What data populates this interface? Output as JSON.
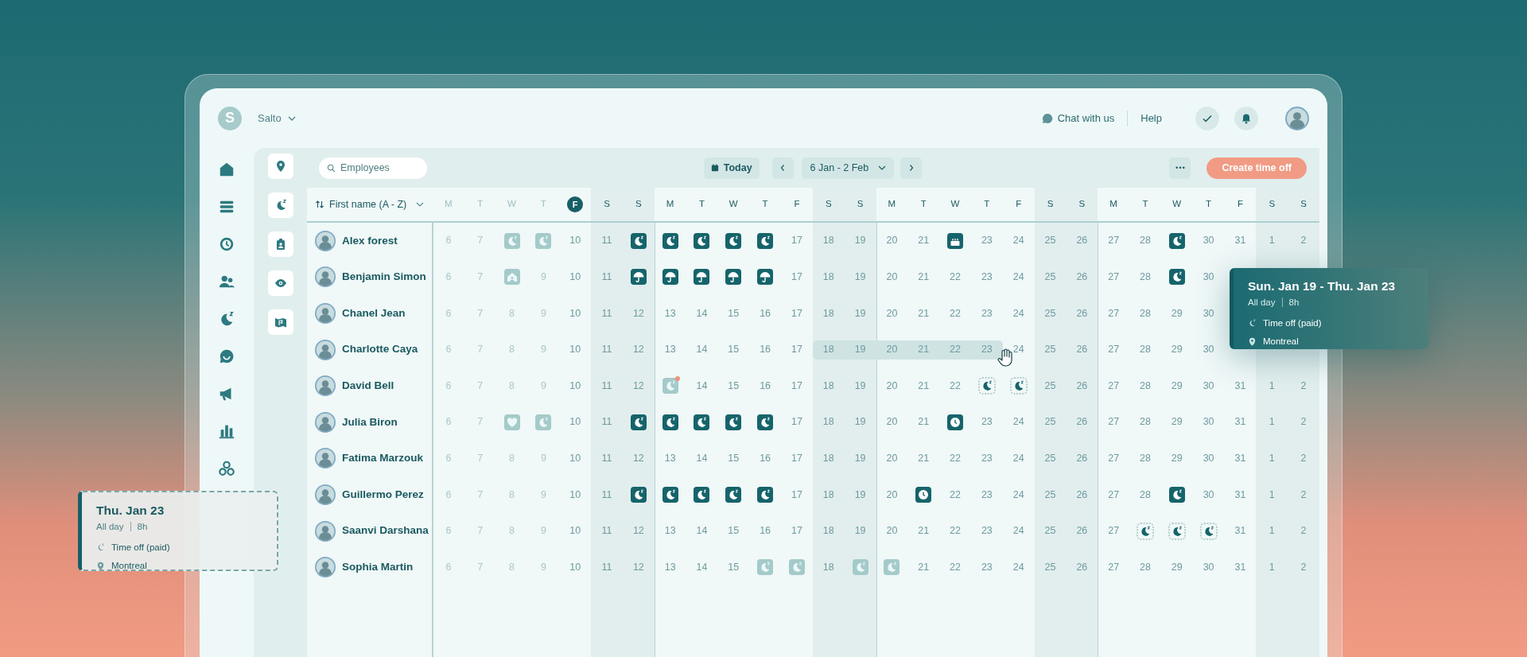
{
  "header": {
    "logo_initial": "S",
    "workspace": "Salto",
    "chat": "Chat with us",
    "help": "Help"
  },
  "toolbar": {
    "search": {
      "placeholder": "Employees"
    },
    "today": "Today",
    "date_range": "6 Jan - 2 Feb",
    "create": "Create time off"
  },
  "table": {
    "sort_label": "First name (A - Z)",
    "days": [
      {
        "letter": "M",
        "kind": "past",
        "weekend": false,
        "week_start": true
      },
      {
        "letter": "T",
        "kind": "past",
        "weekend": false,
        "week_start": false
      },
      {
        "letter": "W",
        "kind": "past",
        "weekend": false,
        "week_start": false
      },
      {
        "letter": "T",
        "kind": "past",
        "weekend": false,
        "week_start": false
      },
      {
        "letter": "F",
        "kind": "today",
        "weekend": false,
        "week_start": false
      },
      {
        "letter": "S",
        "kind": "day",
        "weekend": true,
        "week_start": false
      },
      {
        "letter": "S",
        "kind": "day",
        "weekend": true,
        "week_start": false
      },
      {
        "letter": "M",
        "kind": "day",
        "weekend": false,
        "week_start": true
      },
      {
        "letter": "T",
        "kind": "day",
        "weekend": false,
        "week_start": false
      },
      {
        "letter": "W",
        "kind": "day",
        "weekend": false,
        "week_start": false
      },
      {
        "letter": "T",
        "kind": "day",
        "weekend": false,
        "week_start": false
      },
      {
        "letter": "F",
        "kind": "day",
        "weekend": false,
        "week_start": false
      },
      {
        "letter": "S",
        "kind": "day",
        "weekend": true,
        "week_start": false
      },
      {
        "letter": "S",
        "kind": "day",
        "weekend": true,
        "week_start": false
      },
      {
        "letter": "M",
        "kind": "day",
        "weekend": false,
        "week_start": true
      },
      {
        "letter": "T",
        "kind": "day",
        "weekend": false,
        "week_start": false
      },
      {
        "letter": "W",
        "kind": "day",
        "weekend": false,
        "week_start": false
      },
      {
        "letter": "T",
        "kind": "day",
        "weekend": false,
        "week_start": false
      },
      {
        "letter": "F",
        "kind": "day",
        "weekend": false,
        "week_start": false
      },
      {
        "letter": "S",
        "kind": "day",
        "weekend": true,
        "week_start": false
      },
      {
        "letter": "S",
        "kind": "day",
        "weekend": true,
        "week_start": false
      },
      {
        "letter": "M",
        "kind": "day",
        "weekend": false,
        "week_start": true
      },
      {
        "letter": "T",
        "kind": "day",
        "weekend": false,
        "week_start": false
      },
      {
        "letter": "W",
        "kind": "day",
        "weekend": false,
        "week_start": false
      },
      {
        "letter": "T",
        "kind": "day",
        "weekend": false,
        "week_start": false
      },
      {
        "letter": "F",
        "kind": "day",
        "weekend": false,
        "week_start": false
      },
      {
        "letter": "S",
        "kind": "day",
        "weekend": true,
        "week_start": false
      },
      {
        "letter": "S",
        "kind": "day",
        "weekend": true,
        "week_start": false
      }
    ],
    "rows": [
      {
        "name": "Alex forest",
        "cells": [
          {
            "kind": "past",
            "text": "6"
          },
          {
            "kind": "past",
            "text": "7"
          },
          {
            "kind": "moon",
            "faded": true,
            "pending": false
          },
          {
            "kind": "moon",
            "faded": true,
            "pending": false
          },
          {
            "kind": "day",
            "text": "10"
          },
          {
            "kind": "day",
            "text": "11"
          },
          {
            "kind": "moon",
            "faded": false,
            "pending": false
          },
          {
            "kind": "moon",
            "faded": false,
            "pending": false
          },
          {
            "kind": "moon",
            "faded": false,
            "pending": false
          },
          {
            "kind": "moon",
            "faded": false,
            "pending": false
          },
          {
            "kind": "moon",
            "faded": false,
            "pending": false
          },
          {
            "kind": "day",
            "text": "17"
          },
          {
            "kind": "day",
            "text": "18"
          },
          {
            "kind": "day",
            "text": "19"
          },
          {
            "kind": "day",
            "text": "20"
          },
          {
            "kind": "day",
            "text": "21"
          },
          {
            "kind": "cake",
            "faded": false,
            "pending": false
          },
          {
            "kind": "day",
            "text": "23"
          },
          {
            "kind": "day",
            "text": "24"
          },
          {
            "kind": "day",
            "text": "25"
          },
          {
            "kind": "day",
            "text": "26"
          },
          {
            "kind": "day",
            "text": "27"
          },
          {
            "kind": "day",
            "text": "28"
          },
          {
            "kind": "moon",
            "faded": false,
            "pending": false
          },
          {
            "kind": "day",
            "text": "30"
          },
          {
            "kind": "day",
            "text": "31"
          },
          {
            "kind": "day",
            "text": "1"
          },
          {
            "kind": "day",
            "text": "2"
          }
        ]
      },
      {
        "name": "Benjamin Simon",
        "cells": [
          {
            "kind": "past",
            "text": "6"
          },
          {
            "kind": "past",
            "text": "7"
          },
          {
            "kind": "house",
            "faded": true,
            "pending": false
          },
          {
            "kind": "past",
            "text": "9"
          },
          {
            "kind": "day",
            "text": "10"
          },
          {
            "kind": "day",
            "text": "11"
          },
          {
            "kind": "umbrella",
            "faded": false,
            "pending": false
          },
          {
            "kind": "umbrella",
            "faded": false,
            "pending": false
          },
          {
            "kind": "umbrella",
            "faded": false,
            "pending": false
          },
          {
            "kind": "umbrella",
            "faded": false,
            "pending": false
          },
          {
            "kind": "umbrella",
            "faded": false,
            "pending": false
          },
          {
            "kind": "day",
            "text": "17"
          },
          {
            "kind": "day",
            "text": "18"
          },
          {
            "kind": "day",
            "text": "19"
          },
          {
            "kind": "day",
            "text": "20"
          },
          {
            "kind": "day",
            "text": "21"
          },
          {
            "kind": "day",
            "text": "22"
          },
          {
            "kind": "day",
            "text": "23"
          },
          {
            "kind": "day",
            "text": "24"
          },
          {
            "kind": "day",
            "text": "25"
          },
          {
            "kind": "day",
            "text": "26"
          },
          {
            "kind": "day",
            "text": "27"
          },
          {
            "kind": "day",
            "text": "28"
          },
          {
            "kind": "moon",
            "faded": false,
            "pending": false
          },
          {
            "kind": "day",
            "text": "30"
          }
        ]
      },
      {
        "name": "Chanel Jean",
        "cells": [
          {
            "kind": "past",
            "text": "6"
          },
          {
            "kind": "past",
            "text": "7"
          },
          {
            "kind": "past",
            "text": "8"
          },
          {
            "kind": "past",
            "text": "9"
          },
          {
            "kind": "day",
            "text": "10"
          },
          {
            "kind": "day",
            "text": "11"
          },
          {
            "kind": "day",
            "text": "12"
          },
          {
            "kind": "day",
            "text": "13"
          },
          {
            "kind": "day",
            "text": "14"
          },
          {
            "kind": "day",
            "text": "15"
          },
          {
            "kind": "day",
            "text": "16"
          },
          {
            "kind": "day",
            "text": "17"
          },
          {
            "kind": "day",
            "text": "18"
          },
          {
            "kind": "day",
            "text": "19"
          },
          {
            "kind": "day",
            "text": "20"
          },
          {
            "kind": "day",
            "text": "21"
          },
          {
            "kind": "day",
            "text": "22"
          },
          {
            "kind": "day",
            "text": "23"
          },
          {
            "kind": "day",
            "text": "24"
          },
          {
            "kind": "day",
            "text": "25"
          },
          {
            "kind": "day",
            "text": "26"
          },
          {
            "kind": "day",
            "text": "27"
          },
          {
            "kind": "day",
            "text": "28"
          },
          {
            "kind": "day",
            "text": "29"
          },
          {
            "kind": "day",
            "text": "30"
          }
        ]
      },
      {
        "name": "Charlotte Caya",
        "cells": [
          {
            "kind": "past",
            "text": "6"
          },
          {
            "kind": "past",
            "text": "7"
          },
          {
            "kind": "past",
            "text": "8"
          },
          {
            "kind": "past",
            "text": "9"
          },
          {
            "kind": "day",
            "text": "10"
          },
          {
            "kind": "day",
            "text": "11"
          },
          {
            "kind": "day",
            "text": "12"
          },
          {
            "kind": "day",
            "text": "13"
          },
          {
            "kind": "day",
            "text": "14"
          },
          {
            "kind": "day",
            "text": "15"
          },
          {
            "kind": "day",
            "text": "16"
          },
          {
            "kind": "day",
            "text": "17"
          },
          {
            "kind": "range",
            "text": "18"
          },
          {
            "kind": "range",
            "text": "19"
          },
          {
            "kind": "range",
            "text": "20"
          },
          {
            "kind": "range",
            "text": "21"
          },
          {
            "kind": "range",
            "text": "22"
          },
          {
            "kind": "range",
            "text": "23"
          },
          {
            "kind": "day",
            "text": "24"
          },
          {
            "kind": "day",
            "text": "25"
          },
          {
            "kind": "day",
            "text": "26"
          },
          {
            "kind": "day",
            "text": "27"
          },
          {
            "kind": "day",
            "text": "28"
          },
          {
            "kind": "day",
            "text": "29"
          },
          {
            "kind": "day",
            "text": "30"
          }
        ]
      },
      {
        "name": "David Bell",
        "cells": [
          {
            "kind": "past",
            "text": "6"
          },
          {
            "kind": "past",
            "text": "7"
          },
          {
            "kind": "past",
            "text": "8"
          },
          {
            "kind": "past",
            "text": "9"
          },
          {
            "kind": "day",
            "text": "10"
          },
          {
            "kind": "day",
            "text": "11"
          },
          {
            "kind": "day",
            "text": "12"
          },
          {
            "kind": "moon",
            "faded": true,
            "pending": false,
            "alert": true
          },
          {
            "kind": "day",
            "text": "14"
          },
          {
            "kind": "day",
            "text": "15"
          },
          {
            "kind": "day",
            "text": "16"
          },
          {
            "kind": "day",
            "text": "17"
          },
          {
            "kind": "day",
            "text": "18"
          },
          {
            "kind": "day",
            "text": "19"
          },
          {
            "kind": "day",
            "text": "20"
          },
          {
            "kind": "day",
            "text": "21"
          },
          {
            "kind": "day",
            "text": "22"
          },
          {
            "kind": "moon",
            "faded": false,
            "pending": true
          },
          {
            "kind": "moon",
            "faded": false,
            "pending": true
          },
          {
            "kind": "day",
            "text": "25"
          },
          {
            "kind": "day",
            "text": "26"
          },
          {
            "kind": "day",
            "text": "27"
          },
          {
            "kind": "day",
            "text": "28"
          },
          {
            "kind": "day",
            "text": "29"
          },
          {
            "kind": "day",
            "text": "30"
          },
          {
            "kind": "day",
            "text": "31"
          },
          {
            "kind": "day",
            "text": "1"
          },
          {
            "kind": "day",
            "text": "2"
          }
        ]
      },
      {
        "name": "Julia Biron",
        "cells": [
          {
            "kind": "past",
            "text": "6"
          },
          {
            "kind": "past",
            "text": "7"
          },
          {
            "kind": "heart",
            "faded": true,
            "pending": false
          },
          {
            "kind": "moon",
            "faded": true,
            "pending": false
          },
          {
            "kind": "day",
            "text": "10"
          },
          {
            "kind": "day",
            "text": "11"
          },
          {
            "kind": "moon",
            "faded": false,
            "pending": false
          },
          {
            "kind": "moon",
            "faded": false,
            "pending": false
          },
          {
            "kind": "moon",
            "faded": false,
            "pending": false
          },
          {
            "kind": "moon",
            "faded": false,
            "pending": false
          },
          {
            "kind": "moon",
            "faded": false,
            "pending": false
          },
          {
            "kind": "day",
            "text": "17"
          },
          {
            "kind": "day",
            "text": "18"
          },
          {
            "kind": "day",
            "text": "19"
          },
          {
            "kind": "day",
            "text": "20"
          },
          {
            "kind": "day",
            "text": "21"
          },
          {
            "kind": "clock",
            "faded": false,
            "pending": false
          },
          {
            "kind": "day",
            "text": "23"
          },
          {
            "kind": "day",
            "text": "24"
          },
          {
            "kind": "day",
            "text": "25"
          },
          {
            "kind": "day",
            "text": "26"
          },
          {
            "kind": "day",
            "text": "27"
          },
          {
            "kind": "day",
            "text": "28"
          },
          {
            "kind": "day",
            "text": "29"
          },
          {
            "kind": "day",
            "text": "30"
          },
          {
            "kind": "day",
            "text": "31"
          },
          {
            "kind": "day",
            "text": "1"
          },
          {
            "kind": "day",
            "text": "2"
          }
        ]
      },
      {
        "name": "Fatima Marzouk",
        "cells": [
          {
            "kind": "past",
            "text": "6"
          },
          {
            "kind": "past",
            "text": "7"
          },
          {
            "kind": "past",
            "text": "8"
          },
          {
            "kind": "past",
            "text": "9"
          },
          {
            "kind": "day",
            "text": "10"
          },
          {
            "kind": "day",
            "text": "11"
          },
          {
            "kind": "day",
            "text": "12"
          },
          {
            "kind": "day",
            "text": "13"
          },
          {
            "kind": "day",
            "text": "14"
          },
          {
            "kind": "day",
            "text": "15"
          },
          {
            "kind": "day",
            "text": "16"
          },
          {
            "kind": "day",
            "text": "17"
          },
          {
            "kind": "day",
            "text": "18"
          },
          {
            "kind": "day",
            "text": "19"
          },
          {
            "kind": "day",
            "text": "20"
          },
          {
            "kind": "day",
            "text": "21"
          },
          {
            "kind": "day",
            "text": "22"
          },
          {
            "kind": "day",
            "text": "23"
          },
          {
            "kind": "day",
            "text": "24"
          },
          {
            "kind": "day",
            "text": "25"
          },
          {
            "kind": "day",
            "text": "26"
          },
          {
            "kind": "day",
            "text": "27"
          },
          {
            "kind": "day",
            "text": "28"
          },
          {
            "kind": "day",
            "text": "29"
          },
          {
            "kind": "day",
            "text": "30"
          },
          {
            "kind": "day",
            "text": "31"
          },
          {
            "kind": "day",
            "text": "1"
          },
          {
            "kind": "day",
            "text": "2"
          }
        ]
      },
      {
        "name": "Guillermo Perez",
        "cells": [
          {
            "kind": "past",
            "text": "6"
          },
          {
            "kind": "past",
            "text": "7"
          },
          {
            "kind": "past",
            "text": "8"
          },
          {
            "kind": "past",
            "text": "9"
          },
          {
            "kind": "day",
            "text": "10"
          },
          {
            "kind": "day",
            "text": "11"
          },
          {
            "kind": "moon",
            "faded": false,
            "pending": false
          },
          {
            "kind": "moon",
            "faded": false,
            "pending": false
          },
          {
            "kind": "moon",
            "faded": false,
            "pending": false
          },
          {
            "kind": "moon",
            "faded": false,
            "pending": false
          },
          {
            "kind": "moon",
            "faded": false,
            "pending": false
          },
          {
            "kind": "day",
            "text": "17"
          },
          {
            "kind": "day",
            "text": "18"
          },
          {
            "kind": "day",
            "text": "19"
          },
          {
            "kind": "day",
            "text": "20"
          },
          {
            "kind": "clock",
            "faded": false,
            "pending": false
          },
          {
            "kind": "day",
            "text": "22"
          },
          {
            "kind": "day",
            "text": "23"
          },
          {
            "kind": "day",
            "text": "24"
          },
          {
            "kind": "day",
            "text": "25"
          },
          {
            "kind": "day",
            "text": "26"
          },
          {
            "kind": "day",
            "text": "27"
          },
          {
            "kind": "day",
            "text": "28"
          },
          {
            "kind": "moon",
            "faded": false,
            "pending": false
          },
          {
            "kind": "day",
            "text": "30"
          },
          {
            "kind": "day",
            "text": "31"
          },
          {
            "kind": "day",
            "text": "1"
          },
          {
            "kind": "day",
            "text": "2"
          }
        ]
      },
      {
        "name": "Saanvi Darshana",
        "cells": [
          {
            "kind": "past",
            "text": "6"
          },
          {
            "kind": "past",
            "text": "7"
          },
          {
            "kind": "past",
            "text": "8"
          },
          {
            "kind": "past",
            "text": "9"
          },
          {
            "kind": "day",
            "text": "10"
          },
          {
            "kind": "day",
            "text": "11"
          },
          {
            "kind": "day",
            "text": "12"
          },
          {
            "kind": "day",
            "text": "13"
          },
          {
            "kind": "day",
            "text": "14"
          },
          {
            "kind": "day",
            "text": "15"
          },
          {
            "kind": "day",
            "text": "16"
          },
          {
            "kind": "day",
            "text": "17"
          },
          {
            "kind": "day",
            "text": "18"
          },
          {
            "kind": "day",
            "text": "19"
          },
          {
            "kind": "day",
            "text": "20"
          },
          {
            "kind": "day",
            "text": "21"
          },
          {
            "kind": "day",
            "text": "22"
          },
          {
            "kind": "day",
            "text": "23"
          },
          {
            "kind": "day",
            "text": "24"
          },
          {
            "kind": "day",
            "text": "25"
          },
          {
            "kind": "day",
            "text": "26"
          },
          {
            "kind": "day",
            "text": "27"
          },
          {
            "kind": "moon",
            "faded": false,
            "pending": true
          },
          {
            "kind": "moon",
            "faded": false,
            "pending": true
          },
          {
            "kind": "moon",
            "faded": false,
            "pending": true
          },
          {
            "kind": "day",
            "text": "31"
          },
          {
            "kind": "day",
            "text": "1"
          },
          {
            "kind": "day",
            "text": "2"
          }
        ]
      },
      {
        "name": "Sophia Martin",
        "cells": [
          {
            "kind": "past",
            "text": "6"
          },
          {
            "kind": "past",
            "text": "7"
          },
          {
            "kind": "past",
            "text": "8"
          },
          {
            "kind": "past",
            "text": "9"
          },
          {
            "kind": "day",
            "text": "10"
          },
          {
            "kind": "day",
            "text": "11"
          },
          {
            "kind": "day",
            "text": "12"
          },
          {
            "kind": "day",
            "text": "13"
          },
          {
            "kind": "day",
            "text": "14"
          },
          {
            "kind": "day",
            "text": "15"
          },
          {
            "kind": "moon",
            "faded": true,
            "pending": false
          },
          {
            "kind": "moon",
            "faded": true,
            "pending": false
          },
          {
            "kind": "day",
            "text": "18"
          },
          {
            "kind": "moon",
            "faded": true,
            "pending": false
          },
          {
            "kind": "moon",
            "faded": true,
            "pending": false
          },
          {
            "kind": "day",
            "text": "21"
          },
          {
            "kind": "day",
            "text": "22"
          },
          {
            "kind": "day",
            "text": "23"
          },
          {
            "kind": "day",
            "text": "24"
          },
          {
            "kind": "day",
            "text": "25"
          },
          {
            "kind": "day",
            "text": "26"
          },
          {
            "kind": "day",
            "text": "27"
          },
          {
            "kind": "day",
            "text": "28"
          },
          {
            "kind": "day",
            "text": "29"
          },
          {
            "kind": "day",
            "text": "30"
          },
          {
            "kind": "day",
            "text": "31"
          },
          {
            "kind": "day",
            "text": "1"
          },
          {
            "kind": "day",
            "text": "2"
          }
        ]
      }
    ]
  },
  "tooltips": [
    {
      "kind": "solid",
      "title": "Sun. Jan 19 - Thu. Jan 23",
      "time": "All day",
      "hours": "8h",
      "leave_type": "Time off (paid)",
      "location": "Montreal"
    },
    {
      "kind": "draft",
      "title": "Thu. Jan 23",
      "time": "All day",
      "hours": "8h",
      "leave_type": "Time off (paid)",
      "location": "Montreal"
    }
  ]
}
